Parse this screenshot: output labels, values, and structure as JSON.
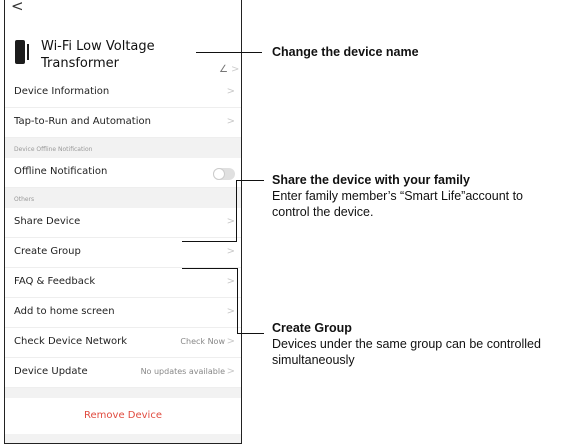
{
  "header": {
    "back_glyph": "<"
  },
  "device": {
    "name": "Wi-Fi Low Voltage Transformer",
    "edit_glyph": "∠",
    "chevron": ">"
  },
  "menu": {
    "device_information": "Device Information",
    "tap_to_run": "Tap-to-Run and Automation",
    "offline_section": "Device Offline Notification",
    "offline_notification": "Offline Notification",
    "others_section": "Others",
    "share_device": "Share Device",
    "create_group": "Create Group",
    "faq": "FAQ & Feedback",
    "add_home": "Add to home screen",
    "check_network": "Check Device Network",
    "check_network_value": "Check Now",
    "device_update": "Device Update",
    "device_update_value": "No updates available",
    "chevron": ">"
  },
  "toggle": {
    "offline_notification_on": false
  },
  "remove": {
    "label": "Remove Device"
  },
  "annotations": {
    "rename_title": "Change the device name",
    "share_title": "Share the device with your family",
    "share_body": "Enter family member’s “Smart Life”account to control the device.",
    "group_title": "Create Group",
    "group_body": "Devices under the same group can be controlled simultaneously"
  },
  "colors": {
    "remove_text": "#e04b3f",
    "background": "#f2f2f2"
  }
}
